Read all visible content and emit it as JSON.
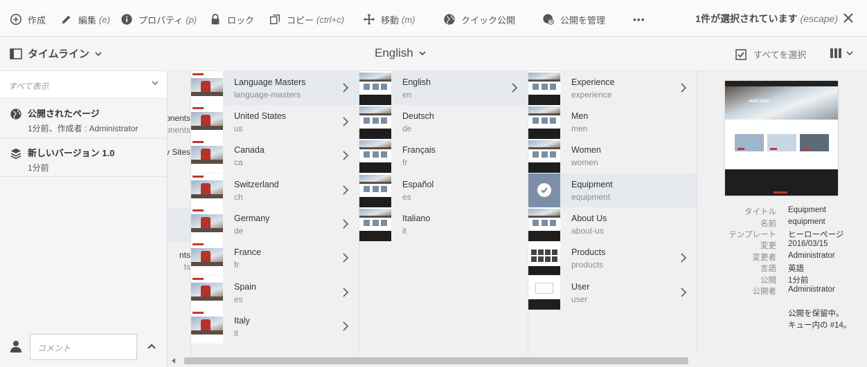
{
  "actionbar": {
    "create": "作成",
    "edit": "編集",
    "edit_hint": "(e)",
    "properties": "プロパティ",
    "properties_hint": "(p)",
    "lock": "ロック",
    "copy": "コピー",
    "copy_hint": "(ctrl+c)",
    "move": "移動",
    "move_hint": "(m)",
    "quick_publish": "クイック公開",
    "manage_publication": "公開を管理",
    "more": "•••",
    "selection_count": "1件が選択されています",
    "selection_hint": "(escape)"
  },
  "titlebar": {
    "rail_label": "タイムライン",
    "title": "English",
    "select_all": "すべてを選択"
  },
  "rail": {
    "filter_placeholder": "すべて表示",
    "items": [
      {
        "title": "公開されたページ",
        "detail": "1分前、作成者 : Administrator"
      },
      {
        "title": "新しいバージョン 1.0",
        "detail": "1分前"
      }
    ],
    "comment_placeholder": "コメント"
  },
  "col0_fragments": [
    "ponents",
    "conents",
    "y Sites",
    "nts",
    "ts"
  ],
  "col1": [
    {
      "title": "Language Masters",
      "name": "language-masters"
    },
    {
      "title": "United States",
      "name": "us"
    },
    {
      "title": "Canada",
      "name": "ca"
    },
    {
      "title": "Switzerland",
      "name": "ch"
    },
    {
      "title": "Germany",
      "name": "de"
    },
    {
      "title": "France",
      "name": "fr"
    },
    {
      "title": "Spain",
      "name": "es"
    },
    {
      "title": "Italy",
      "name": "it"
    }
  ],
  "col2": [
    {
      "title": "English",
      "name": "en"
    },
    {
      "title": "Deutsch",
      "name": "de"
    },
    {
      "title": "Français",
      "name": "fr"
    },
    {
      "title": "Español",
      "name": "es"
    },
    {
      "title": "Italiano",
      "name": "it"
    }
  ],
  "col3": [
    {
      "title": "Experience",
      "name": "experience"
    },
    {
      "title": "Men",
      "name": "men"
    },
    {
      "title": "Women",
      "name": "women"
    },
    {
      "title": "Equipment",
      "name": "equipment"
    },
    {
      "title": "About Us",
      "name": "about-us"
    },
    {
      "title": "Products",
      "name": "products"
    },
    {
      "title": "User",
      "name": "user"
    }
  ],
  "detail": {
    "preview_caption": "HERO PAGE",
    "meta": [
      {
        "key": "タイトル",
        "value": "Equipment"
      },
      {
        "key": "名前",
        "value": "equipment"
      },
      {
        "key": "テンプレート",
        "value": "ヒーローページ"
      },
      {
        "key": "変更",
        "value": "2016/03/15"
      },
      {
        "key": "変更者",
        "value": "Administrator"
      },
      {
        "key": "言語",
        "value": "英語"
      },
      {
        "key": "公開",
        "value": "1分前"
      },
      {
        "key": "公開者",
        "value": "Administrator"
      }
    ],
    "note_line1": "公開を保留中。",
    "note_line2": "キュー内の #14。"
  },
  "colors": {
    "accent": "#2d77d9",
    "brand_red": "#c0392b",
    "active_row": "#e6e9ee"
  }
}
